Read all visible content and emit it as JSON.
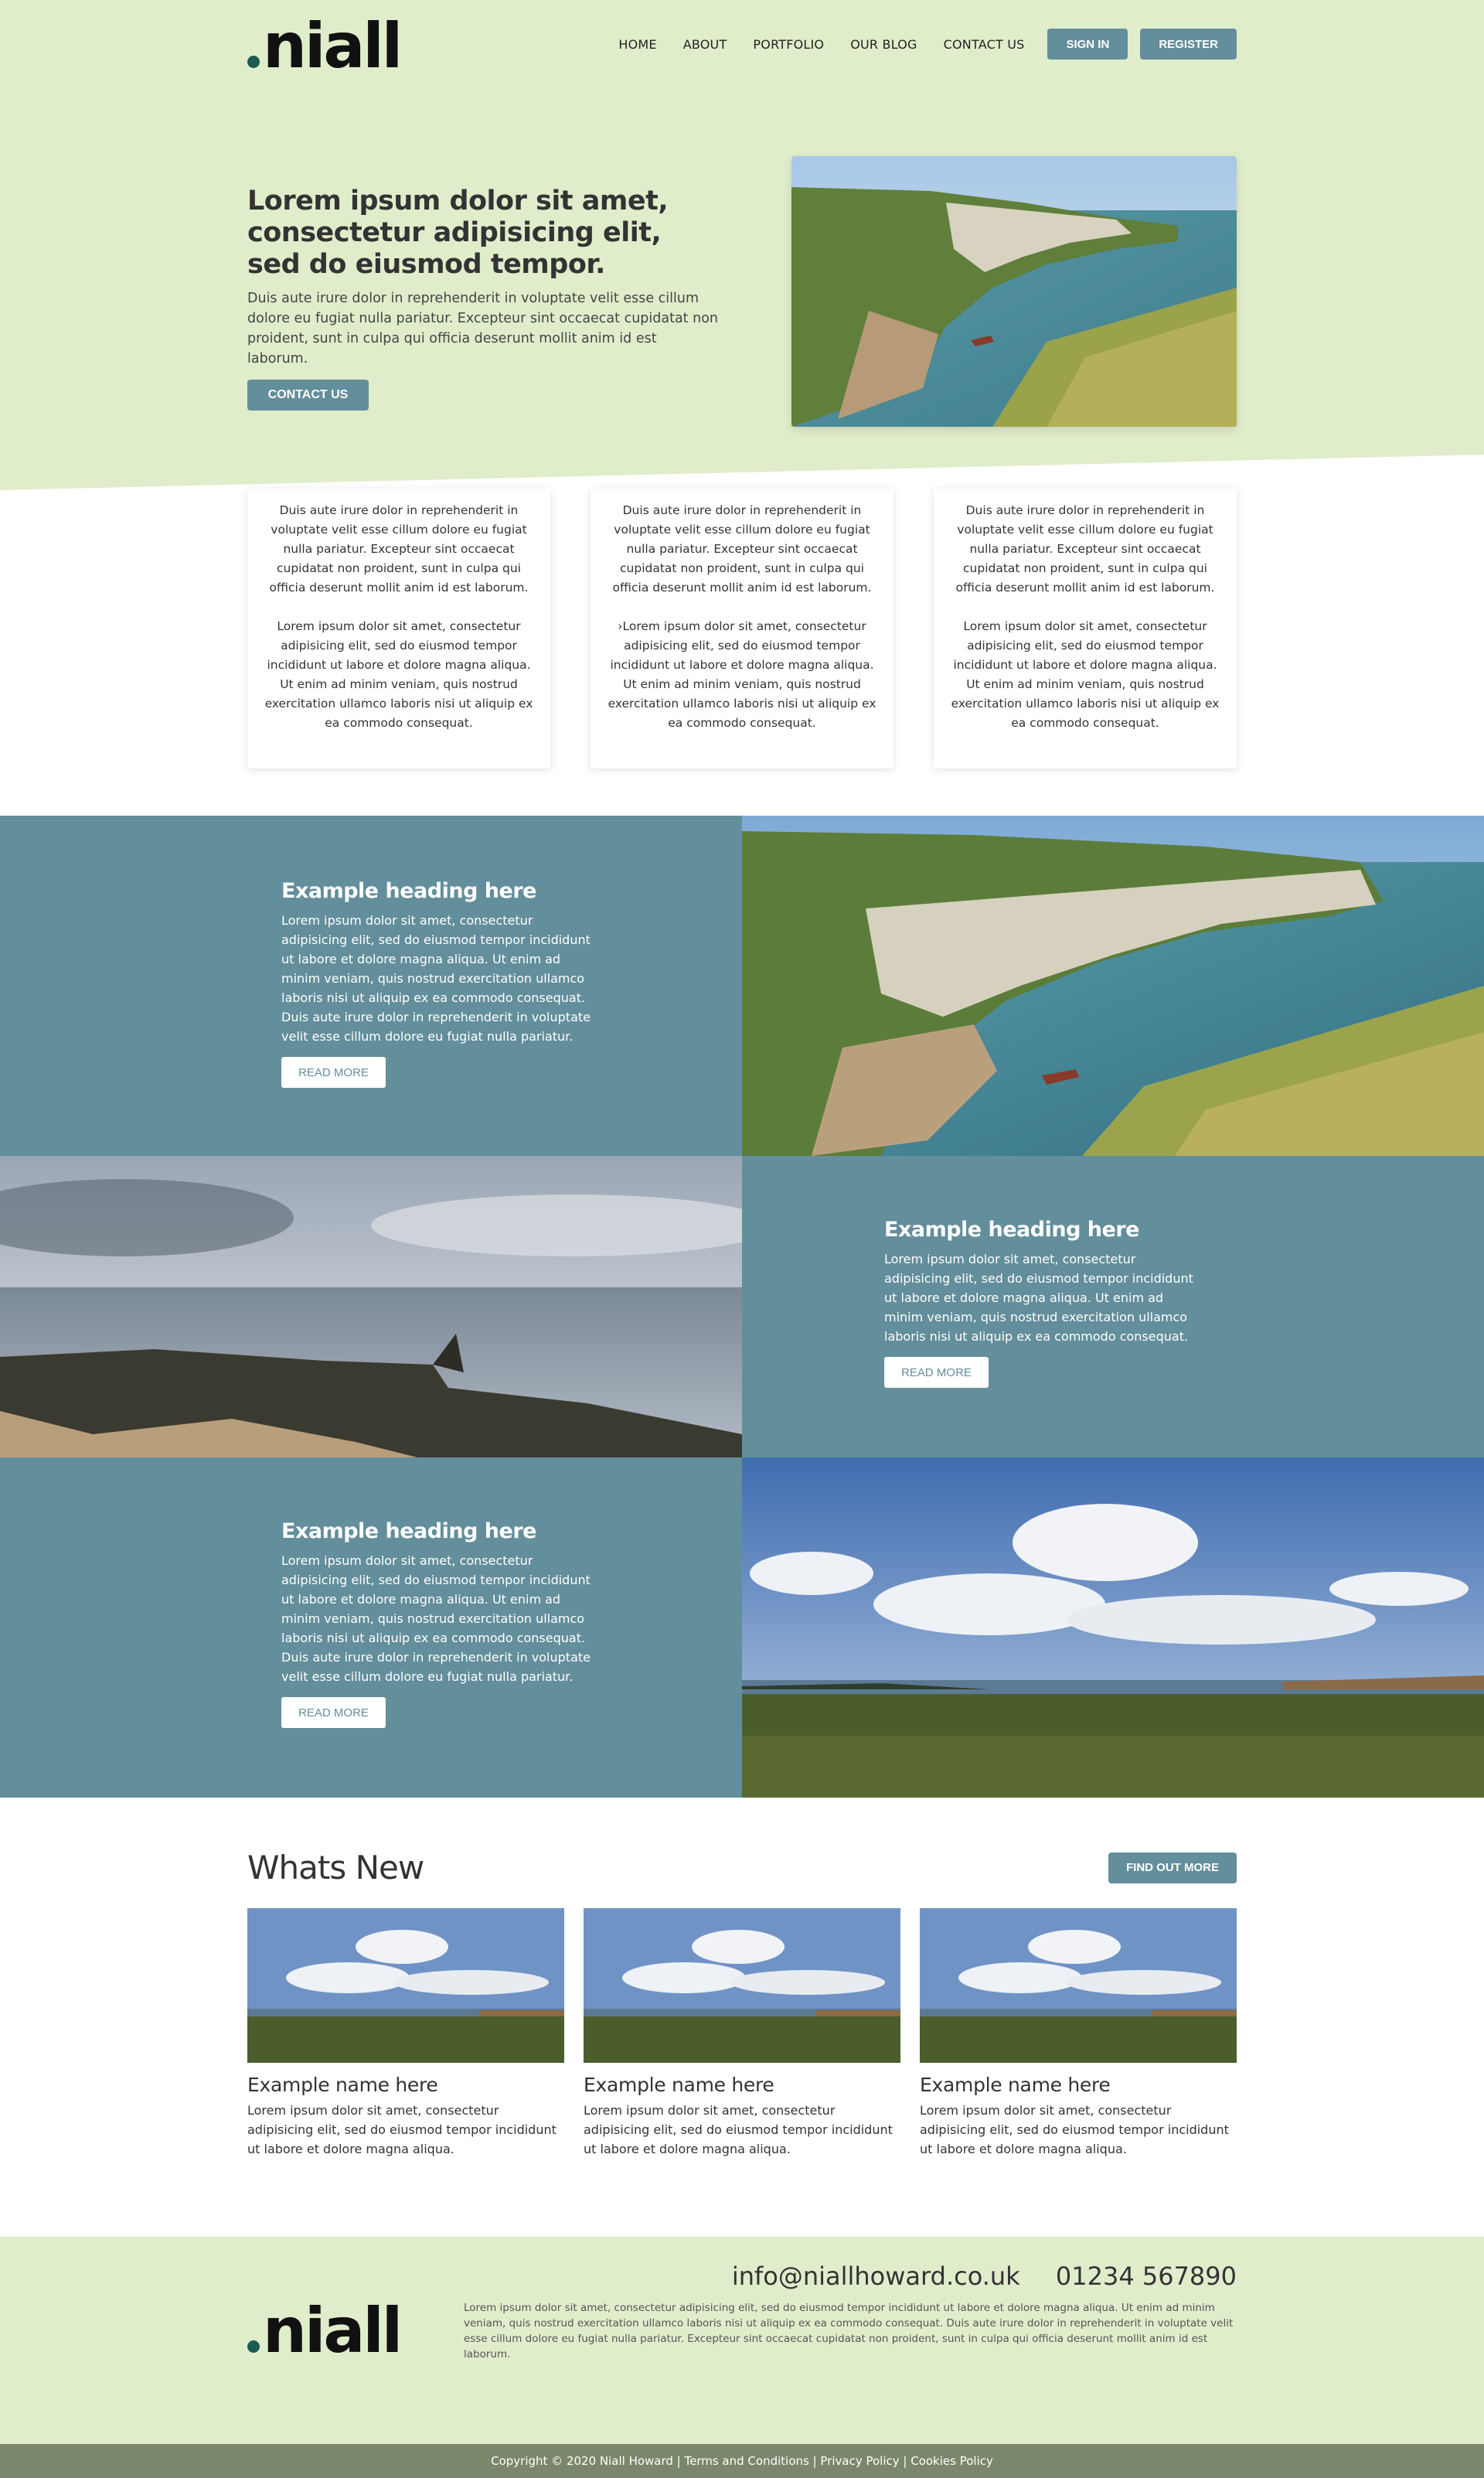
{
  "brand": {
    "logo_text": "niall"
  },
  "nav": {
    "items": [
      "HOME",
      "ABOUT",
      "PORTFOLIO",
      "OUR BLOG",
      "CONTACT US"
    ],
    "sign_in": "SIGN IN",
    "register": "REGISTER"
  },
  "hero": {
    "heading": "Lorem ipsum dolor sit amet, consectetur adipisicing elit, sed do eiusmod tempor.",
    "body": "Duis aute irure dolor in reprehenderit in voluptate velit esse cillum dolore eu fugiat nulla pariatur. Excepteur sint occaecat cupidatat non proident, sunt in culpa qui officia deserunt mollit anim id est laborum.",
    "button": "CONTACT US"
  },
  "cards": [
    {
      "p1": "Duis aute irure dolor in reprehenderit in voluptate velit esse cillum dolore eu fugiat nulla pariatur. Excepteur sint occaecat cupidatat non proident, sunt in culpa qui officia deserunt mollit anim id est laborum.",
      "p2": "Lorem ipsum dolor sit amet, consectetur adipisicing elit, sed do eiusmod tempor incididunt ut labore et dolore magna aliqua. Ut enim ad minim veniam, quis nostrud exercitation ullamco laboris nisi ut aliquip ex ea commodo consequat."
    },
    {
      "p1": "Duis aute irure dolor in reprehenderit in voluptate velit esse cillum dolore eu fugiat nulla pariatur. Excepteur sint occaecat cupidatat non proident, sunt in culpa qui officia deserunt mollit anim id est laborum.",
      "p2": "›Lorem ipsum dolor sit amet, consectetur adipisicing elit, sed do eiusmod tempor incididunt ut labore et dolore magna aliqua. Ut enim ad minim veniam, quis nostrud exercitation ullamco laboris nisi ut aliquip ex ea commodo consequat."
    },
    {
      "p1": "Duis aute irure dolor in reprehenderit in voluptate velit esse cillum dolore eu fugiat nulla pariatur. Excepteur sint occaecat cupidatat non proident, sunt in culpa qui officia deserunt mollit anim id est laborum.",
      "p2": "Lorem ipsum dolor sit amet, consectetur adipisicing elit, sed do eiusmod tempor incididunt ut labore et dolore magna aliqua. Ut enim ad minim veniam, quis nostrud exercitation ullamco laboris nisi ut aliquip ex ea commodo consequat."
    }
  ],
  "features": [
    {
      "heading": "Example heading here",
      "body": "Lorem ipsum dolor sit amet, consectetur adipisicing elit, sed do eiusmod tempor incididunt ut labore et dolore magna aliqua. Ut enim ad minim veniam, quis nostrud exercitation ullamco laboris nisi ut aliquip ex ea commodo consequat. Duis aute irure dolor in reprehenderit in voluptate velit esse cillum dolore eu fugiat nulla pariatur.",
      "button": "READ MORE"
    },
    {
      "heading": "Example heading here",
      "body": "Lorem ipsum dolor sit amet, consectetur adipisicing elit, sed do eiusmod tempor incididunt ut labore et dolore magna aliqua. Ut enim ad minim veniam, quis nostrud exercitation ullamco laboris nisi ut aliquip ex ea commodo consequat.",
      "button": "READ MORE"
    },
    {
      "heading": "Example heading here",
      "body": "Lorem ipsum dolor sit amet, consectetur adipisicing elit, sed do eiusmod tempor incididunt ut labore et dolore magna aliqua. Ut enim ad minim veniam, quis nostrud exercitation ullamco laboris nisi ut aliquip ex ea commodo consequat. Duis aute irure dolor in reprehenderit in voluptate velit esse cillum dolore eu fugiat nulla pariatur.",
      "button": "READ MORE"
    }
  ],
  "news": {
    "title": "Whats New",
    "button": "FIND OUT MORE",
    "items": [
      {
        "name": "Example name here",
        "body": "Lorem ipsum dolor sit amet, consectetur adipisicing elit, sed do eiusmod tempor incididunt ut labore et dolore magna aliqua."
      },
      {
        "name": "Example name here",
        "body": "Lorem ipsum dolor sit amet, consectetur adipisicing elit, sed do eiusmod tempor incididunt ut labore et dolore magna aliqua."
      },
      {
        "name": "Example name here",
        "body": "Lorem ipsum dolor sit amet, consectetur adipisicing elit, sed do eiusmod tempor incididunt ut labore et dolore magna aliqua."
      }
    ]
  },
  "footer": {
    "email": "info@niallhoward.co.uk",
    "phone": "01234 567890",
    "body": "Lorem ipsum dolor sit amet, consectetur adipisicing elit, sed do eiusmod tempor incididunt ut labore et dolore magna aliqua. Ut enim ad minim veniam, quis nostrud exercitation ullamco laboris nisi ut aliquip ex ea commodo consequat. Duis aute irure dolor in reprehenderit in voluptate velit esse cillum dolore eu fugiat nulla pariatur. Excepteur sint occaecat cupidatat non proident, sunt in culpa qui officia deserunt mollit anim id est laborum.",
    "copyright": "Copyright © 2020 Niall Howard | Terms and Conditions | Privacy Policy | Cookies Policy"
  },
  "colors": {
    "hero_bg": "#e0edcb",
    "accent": "#638e9b",
    "brand_dot": "#1c5b4f",
    "copyright_bg": "#7b876a"
  }
}
